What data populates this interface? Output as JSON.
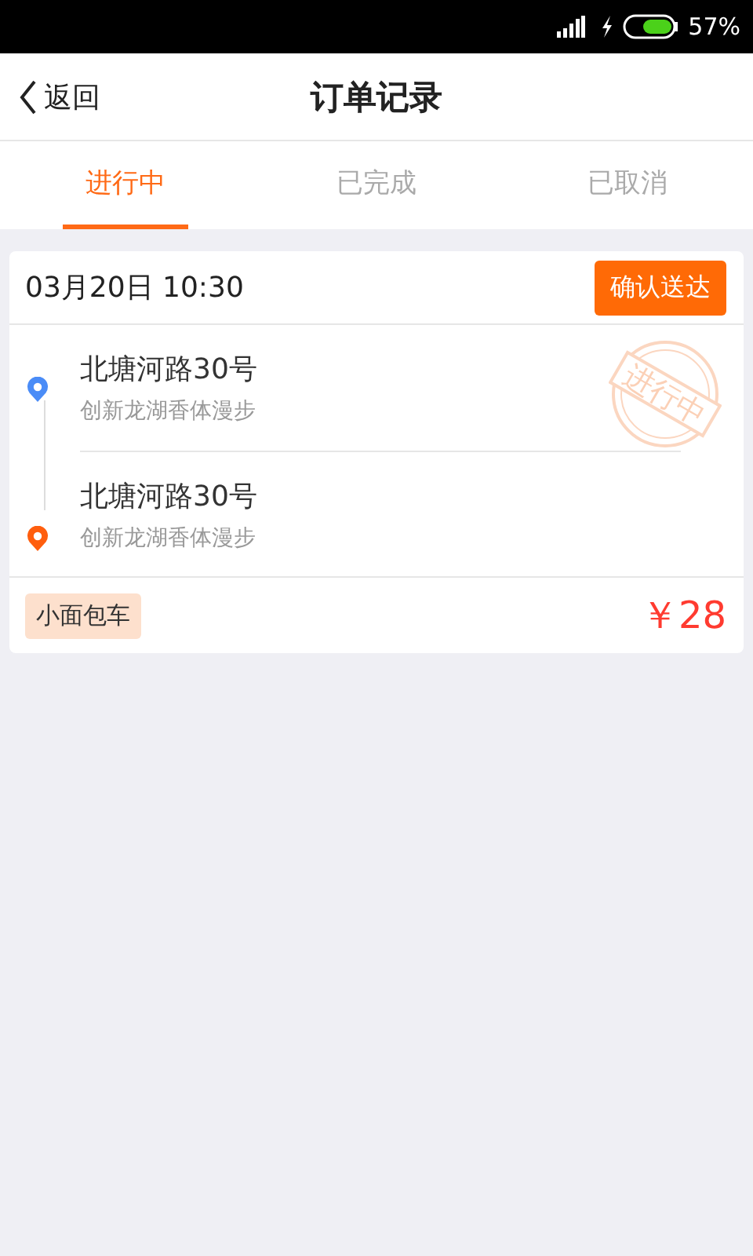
{
  "status_bar": {
    "battery": "57%"
  },
  "header": {
    "back": "返回",
    "title": "订单记录"
  },
  "tabs": [
    {
      "label": "进行中",
      "selected": true
    },
    {
      "label": "已完成",
      "selected": false
    },
    {
      "label": "已取消",
      "selected": false
    }
  ],
  "orders": [
    {
      "time": "03月20日 10:30",
      "action": "确认送达",
      "stamp": "进行中",
      "stops": [
        {
          "kind": "start",
          "color": "#4a8cf7",
          "address": "北塘河路30号",
          "detail": "创新龙湖香体漫步"
        },
        {
          "kind": "end",
          "color": "#ff5e0e",
          "address": "北塘河路30号",
          "detail": "创新龙湖香体漫步"
        }
      ],
      "vehicle": "小面包车",
      "price": "￥28"
    }
  ]
}
